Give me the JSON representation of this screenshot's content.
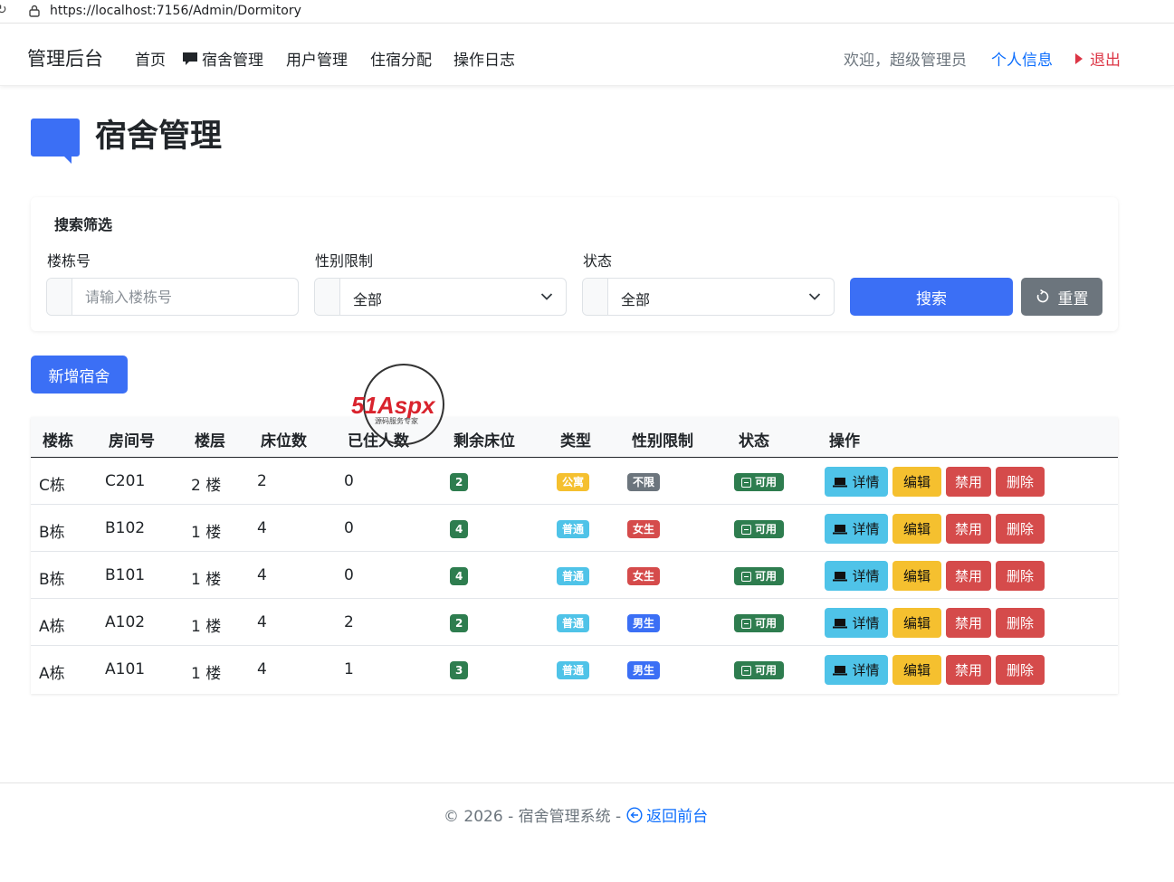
{
  "browser": {
    "url": "https://localhost:7156/Admin/Dormitory"
  },
  "navbar": {
    "brand": "管理后台",
    "items": [
      {
        "label": "首页",
        "icon": ""
      },
      {
        "label": "宿舍管理",
        "icon": "chat-square-icon"
      },
      {
        "label": "用户管理",
        "icon": ""
      },
      {
        "label": "住宿分配",
        "icon": ""
      },
      {
        "label": "操作日志",
        "icon": ""
      }
    ],
    "welcome": "欢迎，超级管理员",
    "profile": "个人信息",
    "logout": "退出"
  },
  "page": {
    "title": "宿舍管理",
    "title_icon": "chat-square-icon"
  },
  "search": {
    "title": "搜索筛选",
    "building_label": "楼栋号",
    "building_placeholder": "请输入楼栋号",
    "gender_label": "性别限制",
    "gender_value": "全部",
    "status_label": "状态",
    "status_value": "全部",
    "search_button": "搜索",
    "reset_button": "重置"
  },
  "add_button": "新增宿舍",
  "watermark": {
    "brand": "51Aspx",
    "tagline": "源码服务专家"
  },
  "table": {
    "headers": [
      "楼栋",
      "房间号",
      "楼层",
      "床位数",
      "已住人数",
      "剩余床位",
      "类型",
      "性别限制",
      "状态",
      "操作"
    ],
    "actions": {
      "detail": "详情",
      "edit": "编辑",
      "disable": "禁用",
      "delete": "删除"
    },
    "rows": [
      {
        "building": "C栋",
        "room": "C201",
        "floor": "2 楼",
        "beds": "2",
        "occupied": "0",
        "remaining": "2",
        "type": "公寓",
        "gender": "不限",
        "status": "可用"
      },
      {
        "building": "B栋",
        "room": "B102",
        "floor": "1 楼",
        "beds": "4",
        "occupied": "0",
        "remaining": "4",
        "type": "普通",
        "gender": "女生",
        "status": "可用"
      },
      {
        "building": "B栋",
        "room": "B101",
        "floor": "1 楼",
        "beds": "4",
        "occupied": "0",
        "remaining": "4",
        "type": "普通",
        "gender": "女生",
        "status": "可用"
      },
      {
        "building": "A栋",
        "room": "A102",
        "floor": "1 楼",
        "beds": "4",
        "occupied": "2",
        "remaining": "2",
        "type": "普通",
        "gender": "男生",
        "status": "可用"
      },
      {
        "building": "A栋",
        "room": "A101",
        "floor": "1 楼",
        "beds": "4",
        "occupied": "1",
        "remaining": "3",
        "type": "普通",
        "gender": "男生",
        "status": "可用"
      }
    ]
  },
  "colors": {
    "primary": "#3b6ff5",
    "success": "#2e7d4f",
    "info": "#4fc3e8",
    "warning": "#f5c02f",
    "danger": "#d54b4b",
    "secondary": "#6c757d",
    "male": "#3b6ff5",
    "female": "#d54b4b",
    "any": "#6c757d"
  },
  "footer": {
    "text": "© 2026 - 宿舍管理系统 -",
    "link": "返回前台"
  }
}
